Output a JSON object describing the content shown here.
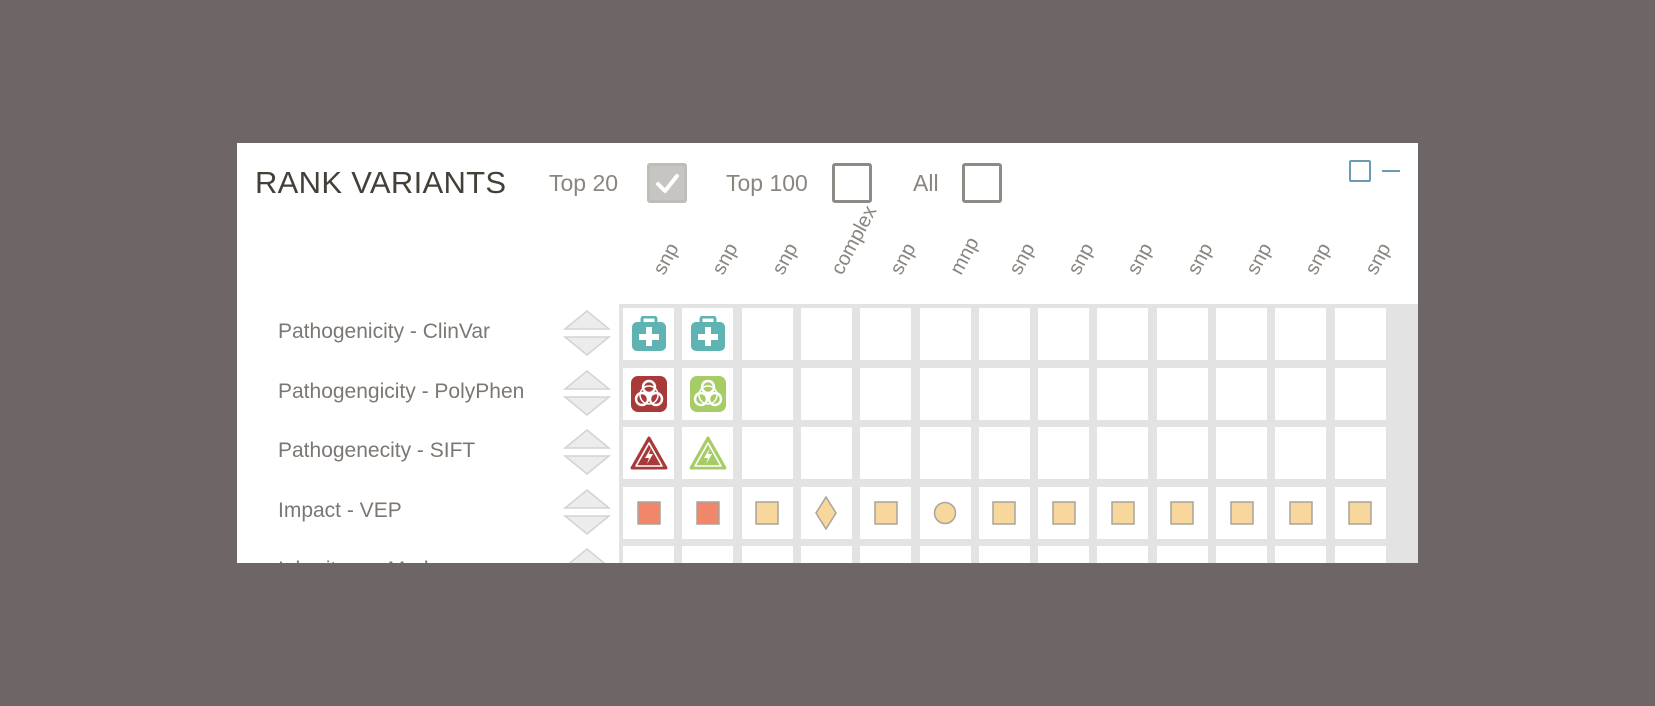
{
  "panel": {
    "title": "RANK VARIANTS",
    "filters": [
      {
        "label": "Top 20",
        "checked": true
      },
      {
        "label": "Top 100",
        "checked": false
      },
      {
        "label": "All",
        "checked": false
      }
    ],
    "window_controls": [
      "maximize-icon",
      "minimize-icon"
    ]
  },
  "columns": [
    "snp",
    "snp",
    "snp",
    "complex",
    "snp",
    "mnp",
    "snp",
    "snp",
    "snp",
    "snp",
    "snp",
    "snp",
    "snp"
  ],
  "rows": [
    {
      "label": "Pathogenicity - ClinVar",
      "cells": [
        "clinvar-teal",
        "clinvar-teal",
        "",
        "",
        "",
        "",
        "",
        "",
        "",
        "",
        "",
        "",
        ""
      ]
    },
    {
      "label": "Pathogengicity - PolyPhen",
      "cells": [
        "biohazard-red",
        "biohazard-green",
        "",
        "",
        "",
        "",
        "",
        "",
        "",
        "",
        "",
        "",
        ""
      ]
    },
    {
      "label": "Pathogenecity - SIFT",
      "cells": [
        "sift-red",
        "sift-green",
        "",
        "",
        "",
        "",
        "",
        "",
        "",
        "",
        "",
        "",
        ""
      ]
    },
    {
      "label": "Impact - VEP",
      "cells": [
        "square-orange",
        "square-orange",
        "square-yellow",
        "diamond-yellow",
        "square-yellow",
        "circle-yellow",
        "square-yellow",
        "square-yellow",
        "square-yellow",
        "square-yellow",
        "square-yellow",
        "square-yellow",
        "square-yellow"
      ]
    },
    {
      "label": "Inheritance Mode",
      "cells": [
        "",
        "",
        "",
        "",
        "",
        "",
        "",
        "",
        "",
        "",
        "",
        "",
        ""
      ]
    }
  ],
  "colors": {
    "clinvar_teal": "#5fb3b3",
    "danger_red": "#a93a3a",
    "benign_green": "#a6cc66",
    "impact_high": "#f0876a",
    "impact_moderate": "#f7d79b",
    "accent_blue": "#6a9bb3"
  }
}
